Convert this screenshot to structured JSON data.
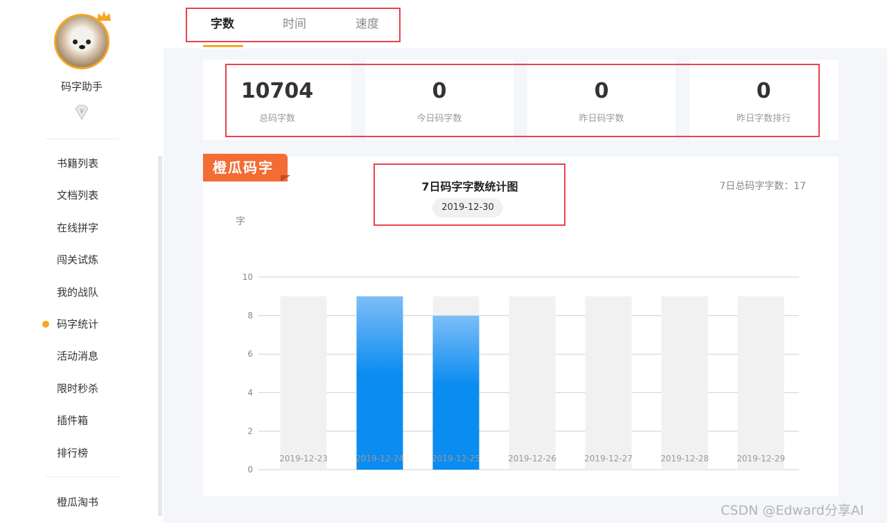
{
  "user": {
    "name": "码字助手",
    "badge_icon": "vip-diamond-icon",
    "crown_icon": "crown-icon"
  },
  "sidebar": {
    "items": [
      {
        "label": "书籍列表",
        "active": false
      },
      {
        "label": "文档列表",
        "active": false
      },
      {
        "label": "在线拼字",
        "active": false
      },
      {
        "label": "闯关试炼",
        "active": false
      },
      {
        "label": "我的战队",
        "active": false
      },
      {
        "label": "码字统计",
        "active": true
      },
      {
        "label": "活动消息",
        "active": false
      },
      {
        "label": "限时秒杀",
        "active": false
      },
      {
        "label": "插件箱",
        "active": false
      },
      {
        "label": "排行榜",
        "active": false
      }
    ],
    "bottom_item": "橙瓜淘书"
  },
  "tabs": [
    {
      "label": "字数",
      "active": true
    },
    {
      "label": "时间",
      "active": false
    },
    {
      "label": "速度",
      "active": false
    }
  ],
  "stats": [
    {
      "value": "10704",
      "label": "总码字数"
    },
    {
      "value": "0",
      "label": "今日码字数"
    },
    {
      "value": "0",
      "label": "昨日码字数"
    },
    {
      "value": "0",
      "label": "昨日字数排行"
    }
  ],
  "chart_panel": {
    "ribbon": "橙瓜码字",
    "title": "7日码字字数统计图",
    "date": "2019-12-30",
    "total_label": "7日总码字字数：17"
  },
  "chart_data": {
    "type": "bar",
    "ylabel": "字",
    "categories": [
      "2019-12-23",
      "2019-12-24",
      "2019-12-25",
      "2019-12-26",
      "2019-12-27",
      "2019-12-28",
      "2019-12-29"
    ],
    "values": [
      0,
      9,
      8,
      0,
      0,
      0,
      0
    ],
    "background_bars": [
      9,
      9,
      9,
      9,
      9,
      9,
      9
    ],
    "ylim": [
      0,
      10
    ],
    "yticks": [
      0,
      2,
      4,
      6,
      8,
      10
    ],
    "grid": true,
    "colors": {
      "bar_top": "#7dbdf7",
      "bar": "#0a8cf0",
      "background_bar": "#f1f1f1"
    }
  },
  "colors": {
    "accent": "#f5a623",
    "ribbon": "#f36c34",
    "highlight": "#e8414b"
  },
  "watermark": "CSDN @Edward分享AI"
}
